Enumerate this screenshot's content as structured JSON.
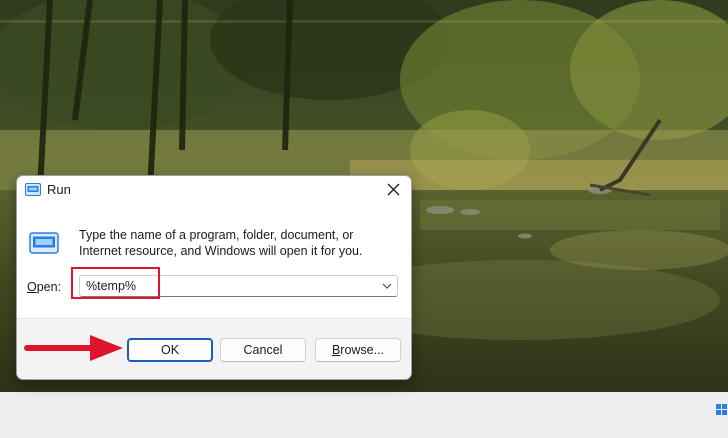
{
  "dialog": {
    "title": "Run",
    "instructions": "Type the name of a program, folder, document, or Internet resource, and Windows will open it for you.",
    "open_label_accesskey": "O",
    "open_label_rest": "pen:",
    "input_value": "%temp%"
  },
  "buttons": {
    "ok": "OK",
    "cancel": "Cancel",
    "browse_accesskey": "B",
    "browse_rest": "rowse..."
  },
  "icons": {
    "title": "run-app-icon",
    "big": "run-app-icon",
    "close": "close-icon",
    "dropdown": "chevron-down-icon"
  },
  "colors": {
    "annotation": "#e0142c",
    "ok_focus_border": "#1a5fb4",
    "footer_bg": "#f3f3f3",
    "taskbar": "#edeef0"
  }
}
